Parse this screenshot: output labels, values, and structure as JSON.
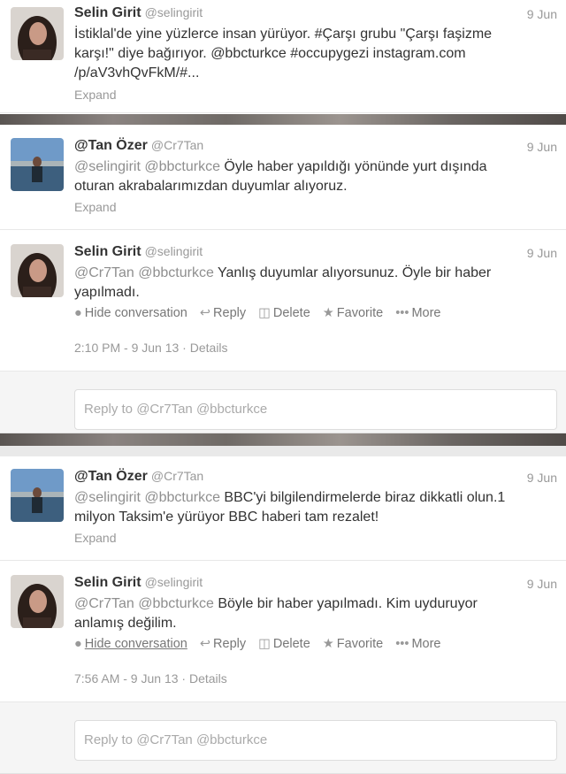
{
  "tweets": [
    {
      "fullname": "Selin Girit",
      "handle": "@selingirit",
      "date": "9 Jun",
      "line1": "İstiklal'de yine yüzlerce insan yürüyor. #Çarşı grubu \"Çarşı faşizme",
      "line2": "karşı!\" diye bağırıyor. @bbcturkce #occupygezi instagram.com",
      "line3": "/p/aV3vhQvFkM/#...",
      "expand": "Expand"
    },
    {
      "fullname": "@Tan Özer",
      "handle": "@Cr7Tan",
      "date": "9 Jun",
      "mentions": "@selingirit @bbcturkce",
      "line1_rest": " Öyle haber yapıldığı yönünde yurt dışında",
      "line2": "oturan akrabalarımızdan duyumlar alıyoruz.",
      "expand": "Expand"
    },
    {
      "fullname": "Selin Girit",
      "handle": "@selingirit",
      "date": "9 Jun",
      "mentions": "@Cr7Tan @bbcturkce",
      "line1_rest": " Yanlış duyumlar alıyorsunuz. Öyle bir haber",
      "line2": "yapılmadı.",
      "meta_time": "2:10 PM - 9 Jun 13",
      "meta_sep": " · ",
      "meta_details": "Details"
    },
    {
      "fullname": "@Tan Özer",
      "handle": "@Cr7Tan",
      "date": "9 Jun",
      "mentions": "@selingirit @bbcturkce",
      "line1_rest": " BBC'yi bilgilendirmelerde biraz dikkatli olun.1",
      "line2": "milyon Taksim'e yürüyor BBC haberi tam rezalet!",
      "expand": "Expand"
    },
    {
      "fullname": "Selin Girit",
      "handle": "@selingirit",
      "date": "9 Jun",
      "mentions": "@Cr7Tan @bbcturkce",
      "line1_rest": " Böyle bir haber yapılmadı. Kim uyduruyor",
      "line2": "anlamış değilim.",
      "meta_time": "7:56 AM - 9 Jun 13",
      "meta_sep": " · ",
      "meta_details": "Details"
    }
  ],
  "actions": {
    "hide": "Hide conversation",
    "reply": "Reply",
    "delete": "Delete",
    "favorite": "Favorite",
    "more": "More"
  },
  "reply_placeholder": "Reply to @Cr7Tan @bbcturkce",
  "icons": [
    "speech-bubble-icon",
    "reply-arrow-icon",
    "trash-icon",
    "star-icon",
    "ellipsis-icon"
  ],
  "colors": {
    "link_gray": "#8f8f8f",
    "text": "#333333",
    "muted": "#999999"
  }
}
